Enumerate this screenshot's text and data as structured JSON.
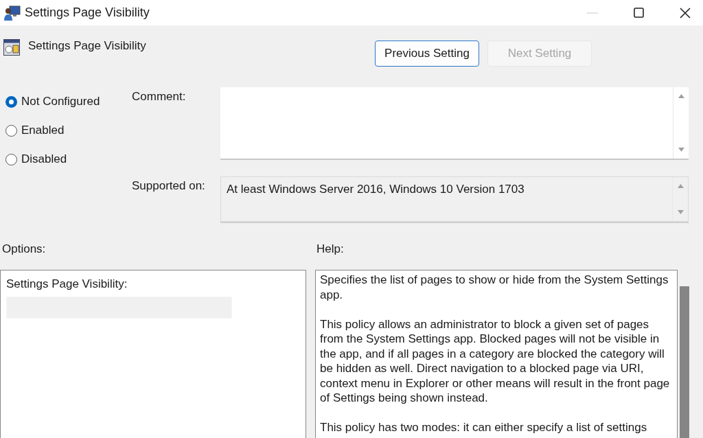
{
  "window": {
    "title": "Settings Page Visibility"
  },
  "policy": {
    "name": "Settings Page Visibility"
  },
  "navigation": [
    {
      "label": "Previous Setting",
      "focused": true,
      "disabled": false
    },
    {
      "label": "Next Setting",
      "focused": false,
      "disabled": true
    }
  ],
  "state_options": [
    {
      "label": "Not Configured",
      "selected": true
    },
    {
      "label": "Enabled",
      "selected": false
    },
    {
      "label": "Disabled",
      "selected": false
    }
  ],
  "comment": {
    "label": "Comment:"
  },
  "supported_on": {
    "label": "Supported on:",
    "value": "At least Windows Server 2016, Windows 10 Version 1703"
  },
  "options": {
    "title": "Options:",
    "field_label": "Settings Page Visibility:"
  },
  "help": {
    "title": "Help:",
    "paragraphs": [
      "Specifies the list of pages to show or hide from the System Settings app.",
      "This policy allows an administrator to block a given set of pages from the System Settings app. Blocked pages will not be visible in the app, and if all pages in a category are blocked the category will be hidden as well. Direct navigation to a blocked page via URI, context menu in Explorer or other means will result in the front page of Settings being shown instead.",
      "This policy has two modes: it can either specify a list of settings"
    ]
  }
}
